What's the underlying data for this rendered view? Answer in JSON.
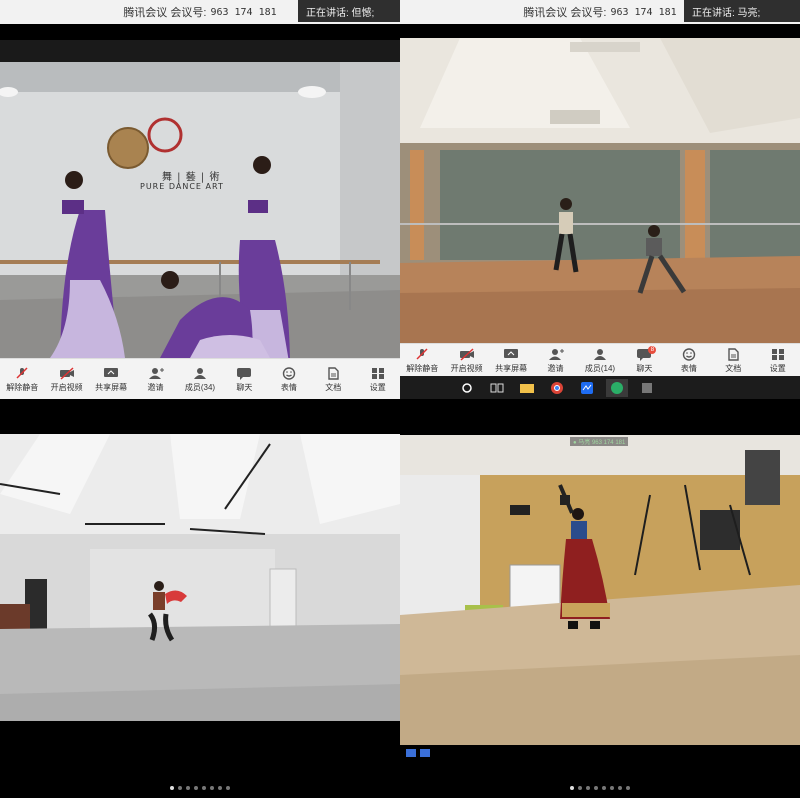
{
  "meeting": {
    "app_label": "腾讯会议",
    "id_label": "会议号:",
    "id_value": "963 174 181"
  },
  "top_left": {
    "speaking_text": "正在讲话: 但憾;",
    "studio_sign_cn": "舞 | 藝 | 術",
    "studio_sign_en": "PURE DANCE ART"
  },
  "top_right": {
    "speaking_text": "正在讲话: 马亮;"
  },
  "toolbar_left": {
    "items": [
      {
        "label": "解除静音",
        "icon": "mic-muted-icon"
      },
      {
        "label": "开启视频",
        "icon": "camera-off-icon"
      },
      {
        "label": "共享屏幕",
        "icon": "share-screen-icon"
      },
      {
        "label": "邀请",
        "icon": "invite-icon"
      },
      {
        "label": "成员(34)",
        "icon": "members-icon"
      },
      {
        "label": "聊天",
        "icon": "chat-icon"
      },
      {
        "label": "表情",
        "icon": "emoji-icon"
      },
      {
        "label": "文档",
        "icon": "document-icon"
      },
      {
        "label": "设置",
        "icon": "settings-icon"
      }
    ]
  },
  "toolbar_right": {
    "items": [
      {
        "label": "解除静音",
        "icon": "mic-muted-icon"
      },
      {
        "label": "开启视频",
        "icon": "camera-off-icon"
      },
      {
        "label": "共享屏幕",
        "icon": "share-screen-icon"
      },
      {
        "label": "邀请",
        "icon": "invite-icon"
      },
      {
        "label": "成员(14)",
        "icon": "members-icon"
      },
      {
        "label": "聊天",
        "icon": "chat-icon",
        "badge": "8"
      },
      {
        "label": "表情",
        "icon": "emoji-icon"
      },
      {
        "label": "文档",
        "icon": "document-icon"
      },
      {
        "label": "设置",
        "icon": "settings-icon"
      }
    ]
  },
  "bottom_right": {
    "overlay_label": "● 马亮 963 174 181"
  }
}
